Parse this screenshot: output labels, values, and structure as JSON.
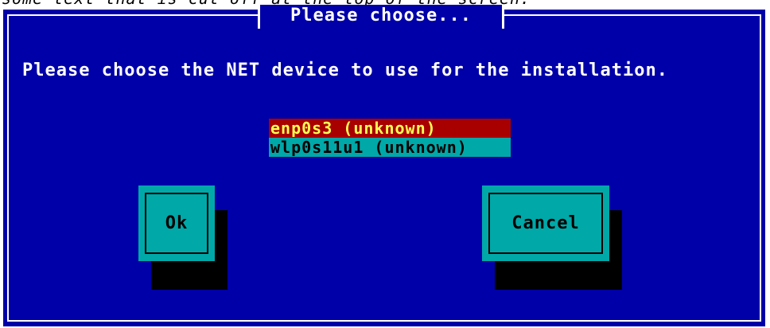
{
  "top_strip_text": "some text that is cut off at the top of the screen.",
  "dialog": {
    "title": "Please choose...",
    "message": "Please choose the NET device to use for the installation.",
    "devices": [
      {
        "label": "enp0s3 (unknown)",
        "selected": true
      },
      {
        "label": "wlp0s11u1 (unknown)",
        "selected": false
      }
    ],
    "buttons": {
      "ok_label": "Ok",
      "cancel_label": "Cancel"
    }
  },
  "colors": {
    "dialog_bg": "#0000a8",
    "button_bg": "#00a8a8",
    "selected_bg": "#a80000",
    "selected_fg": "#ffff55",
    "list_bg": "#00a8a8"
  }
}
